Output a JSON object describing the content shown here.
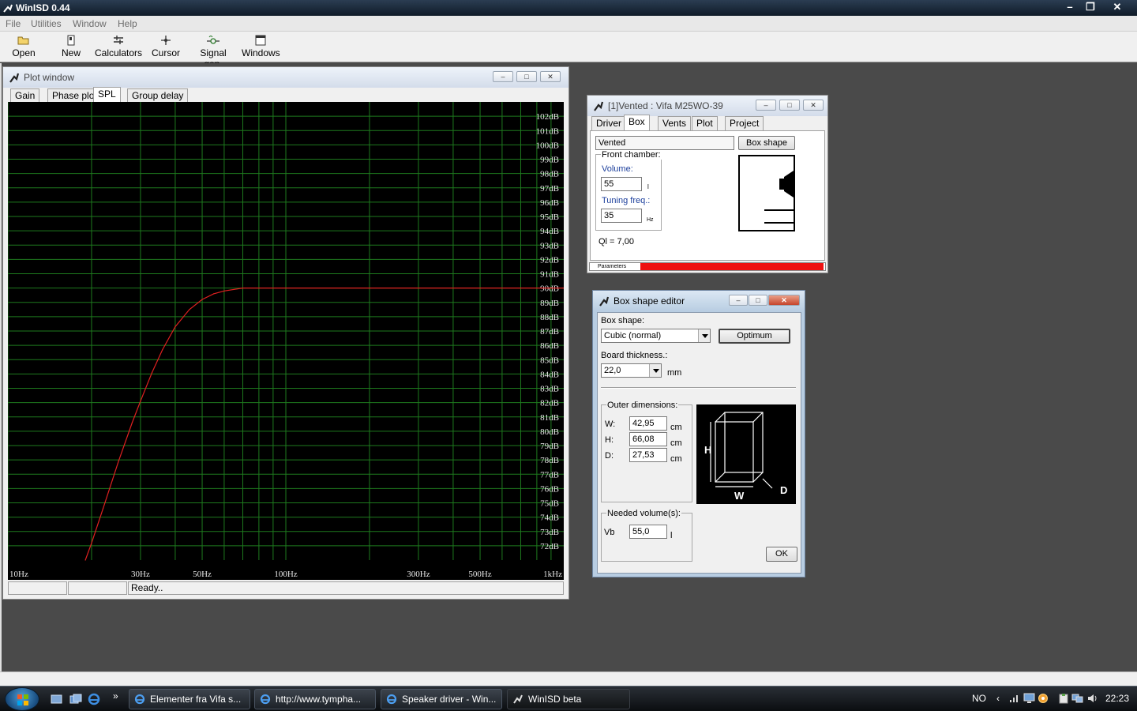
{
  "app": {
    "title": "WinISD 0.44"
  },
  "menu": [
    "File",
    "Utilities",
    "Window",
    "Help"
  ],
  "toolbar": [
    "Open",
    "New",
    "Calculators",
    "Cursor",
    "Signal gen.",
    "Windows"
  ],
  "plot_window": {
    "title": "Plot window",
    "tabs": [
      "Gain",
      "Phase plot",
      "SPL",
      "Group delay"
    ],
    "active_tab": "SPL",
    "status": [
      "",
      "",
      "Ready.."
    ]
  },
  "chart_data": {
    "type": "line",
    "title": "",
    "xlabel": "",
    "ylabel": "",
    "x_scale": "log",
    "xlim": [
      10,
      1000
    ],
    "ylim": [
      71,
      103
    ],
    "x_tick_labels": [
      "10Hz",
      "30Hz",
      "50Hz",
      "100Hz",
      "300Hz",
      "500Hz",
      "1kHz"
    ],
    "x_tick_values": [
      10,
      30,
      50,
      100,
      300,
      500,
      1000
    ],
    "y_tick_labels": [
      "102dB",
      "101dB",
      "100dB",
      "99dB",
      "98dB",
      "97dB",
      "96dB",
      "95dB",
      "94dB",
      "93dB",
      "92dB",
      "91dB",
      "90dB",
      "89dB",
      "88dB",
      "87dB",
      "86dB",
      "85dB",
      "84dB",
      "83dB",
      "82dB",
      "81dB",
      "80dB",
      "79dB",
      "78dB",
      "77dB",
      "76dB",
      "75dB",
      "74dB",
      "73dB",
      "72dB"
    ],
    "y_tick_values": [
      102,
      101,
      100,
      99,
      98,
      97,
      96,
      95,
      94,
      93,
      92,
      91,
      90,
      89,
      88,
      87,
      86,
      85,
      84,
      83,
      82,
      81,
      80,
      79,
      78,
      77,
      76,
      75,
      74,
      73,
      72
    ],
    "grid": true,
    "series": [
      {
        "color": "#e02020",
        "x": [
          19,
          20,
          22,
          25,
          28,
          30,
          33,
          36,
          40,
          45,
          50,
          55,
          60,
          70,
          80,
          100,
          200,
          500,
          1000
        ],
        "y": [
          71,
          72.2,
          74.6,
          77.9,
          80.6,
          82.1,
          84.1,
          85.7,
          87.3,
          88.5,
          89.2,
          89.6,
          89.8,
          90.0,
          90.0,
          90.0,
          90.0,
          90.0,
          90.0
        ]
      }
    ]
  },
  "box_window": {
    "title": "[1]Vented : Vifa M25WO-39",
    "tabs": [
      "Driver",
      "Box",
      "Vents",
      "Plot",
      "Project"
    ],
    "active_tab": "Box",
    "box_type": "Vented",
    "box_shape_button": "Box shape",
    "front_chamber_label": "Front chamber:",
    "volume_label": "Volume:",
    "volume_value": "55",
    "volume_unit": "l",
    "tuning_label": "Tuning freq.:",
    "tuning_value": "35",
    "tuning_unit": "Hz",
    "ql": "Ql = 7,00",
    "progress_label": "Parameters",
    "progress_fraction": 1.0,
    "progress_color": "#ee1111"
  },
  "editor": {
    "title": "Box shape editor",
    "box_shape_label": "Box shape:",
    "box_shape_value": "Cubic (normal)",
    "optimum_button": "Optimum",
    "board_label": "Board thickness.:",
    "board_value": "22,0",
    "board_unit": "mm",
    "outer_label": "Outer dimensions:",
    "w_label": "W:",
    "w_value": "42,95",
    "h_label": "H:",
    "h_value": "66,08",
    "d_label": "D:",
    "d_value": "27,53",
    "dim_unit": "cm",
    "diagram_h": "H",
    "diagram_w": "W",
    "diagram_d": "D",
    "needed_label": "Needed volume(s):",
    "vb_label": "Vb",
    "vb_value": "55,0",
    "vb_unit": "l",
    "ok_button": "OK"
  },
  "taskbar": {
    "tasks": [
      "Elementer fra Vifa s...",
      "http://www.tympha...",
      "Speaker driver - Win...",
      "WinISD beta"
    ],
    "language": "NO",
    "time": "22:23"
  }
}
